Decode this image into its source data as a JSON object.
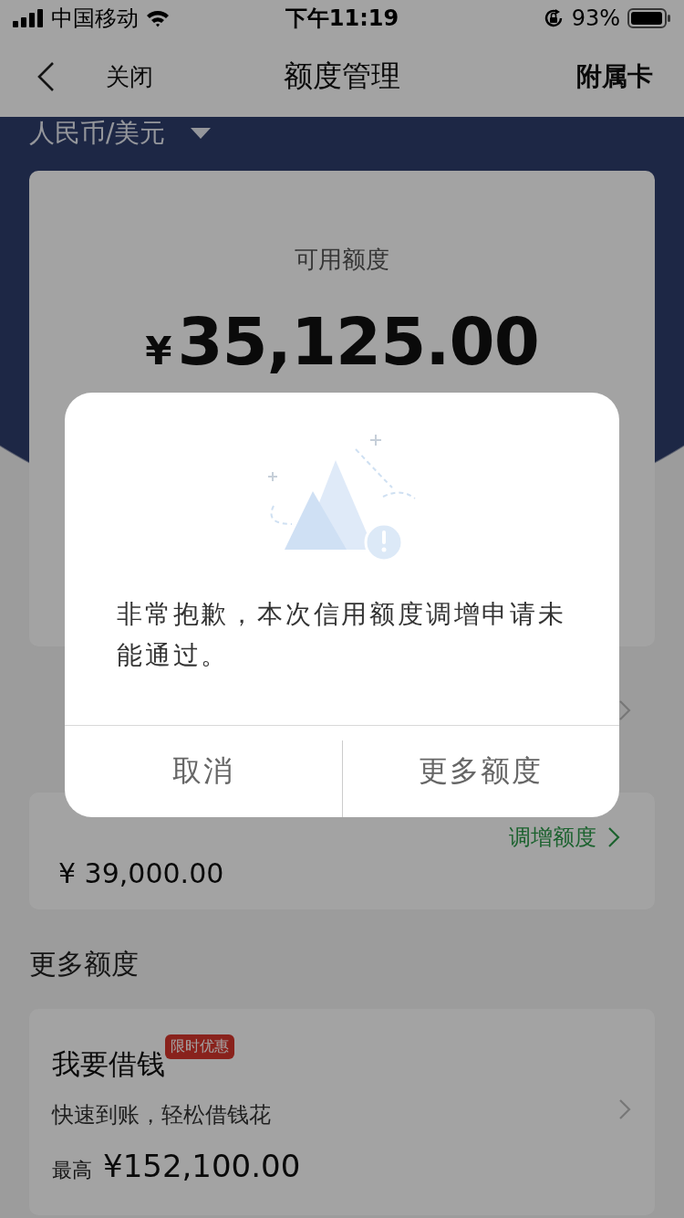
{
  "status_bar": {
    "carrier": "中国移动",
    "time": "下午11:19",
    "battery": "93%"
  },
  "nav": {
    "back_label": "关闭",
    "title": "额度管理",
    "action": "附属卡"
  },
  "currency": {
    "label": "人民币/美元"
  },
  "available": {
    "label": "可用额度",
    "currency_symbol": "¥",
    "amount": "35,125.00"
  },
  "rows": [
    {
      "kind": "link"
    },
    {
      "kind": "amount",
      "amount": "¥ 39,000.00",
      "link": "调增额度"
    }
  ],
  "more_section": {
    "title": "更多额度",
    "items": [
      {
        "title": "我要借钱",
        "badge": "限时优惠",
        "subtitle": "快速到账，轻松借钱花",
        "prefix": "最高",
        "amount": "¥152,100.00"
      }
    ]
  },
  "dialog": {
    "message": "非常抱歉，本次信用额度调增申请未能通过。",
    "buttons": [
      "取消",
      "更多额度"
    ]
  }
}
